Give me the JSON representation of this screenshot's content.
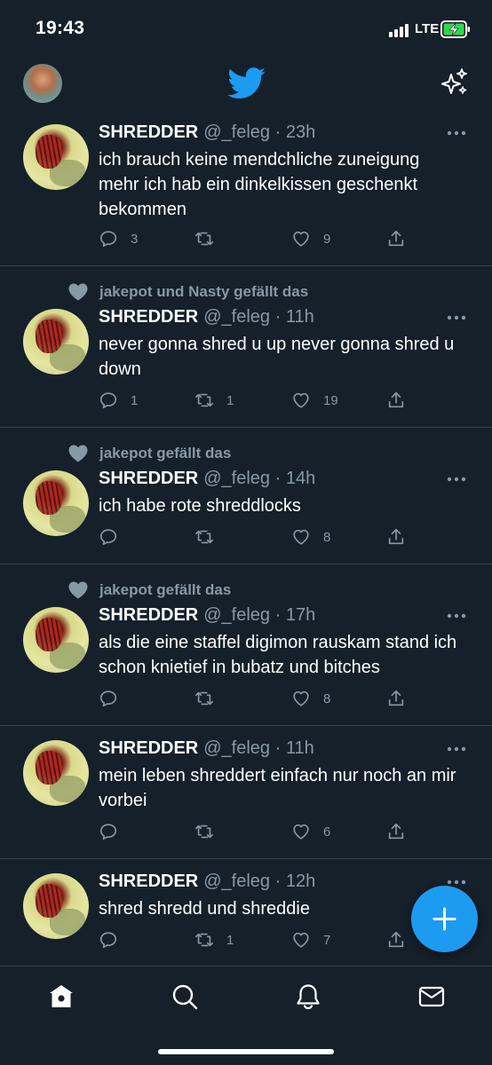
{
  "status_bar": {
    "time": "19:43",
    "network": "LTE"
  },
  "header": {
    "logo_icon": "twitter-bird-icon",
    "right_icon": "sparkle-icon",
    "accent": "#1d9bf0"
  },
  "tweets": [
    {
      "social_context": "",
      "name": "SHREDDER",
      "meta": "@_feleg · 23h",
      "text": "ich brauch keine mendchliche zuneigung mehr ich hab ein dinkelkissen geschenkt bekommen",
      "replies": "3",
      "retweets": "",
      "likes": "9"
    },
    {
      "social_context": "jakepot und Nasty gefällt das",
      "name": "SHREDDER",
      "meta": "@_feleg · 11h",
      "text": "never gonna shred u up never gonna shred u down",
      "replies": "1",
      "retweets": "1",
      "likes": "19"
    },
    {
      "social_context": "jakepot gefällt das",
      "name": "SHREDDER",
      "meta": "@_feleg · 14h",
      "text": "ich habe rote shreddlocks",
      "replies": "",
      "retweets": "",
      "likes": "8"
    },
    {
      "social_context": "jakepot gefällt das",
      "name": "SHREDDER",
      "meta": "@_feleg · 17h",
      "text": "als die eine staffel digimon rauskam stand ich schon knietief in bubatz und bitches",
      "replies": "",
      "retweets": "",
      "likes": "8"
    },
    {
      "social_context": "",
      "name": "SHREDDER",
      "meta": "@_feleg · 11h",
      "text": "mein leben shreddert einfach nur noch an mir vorbei",
      "replies": "",
      "retweets": "",
      "likes": "6"
    },
    {
      "social_context": "",
      "name": "SHREDDER",
      "meta": "@_feleg · 12h",
      "text": "shred shredd und shreddie",
      "replies": "",
      "retweets": "1",
      "likes": "7"
    }
  ],
  "tab_bar": [
    "home-icon",
    "search-icon",
    "notifications-bell-icon",
    "messages-envelope-icon"
  ]
}
